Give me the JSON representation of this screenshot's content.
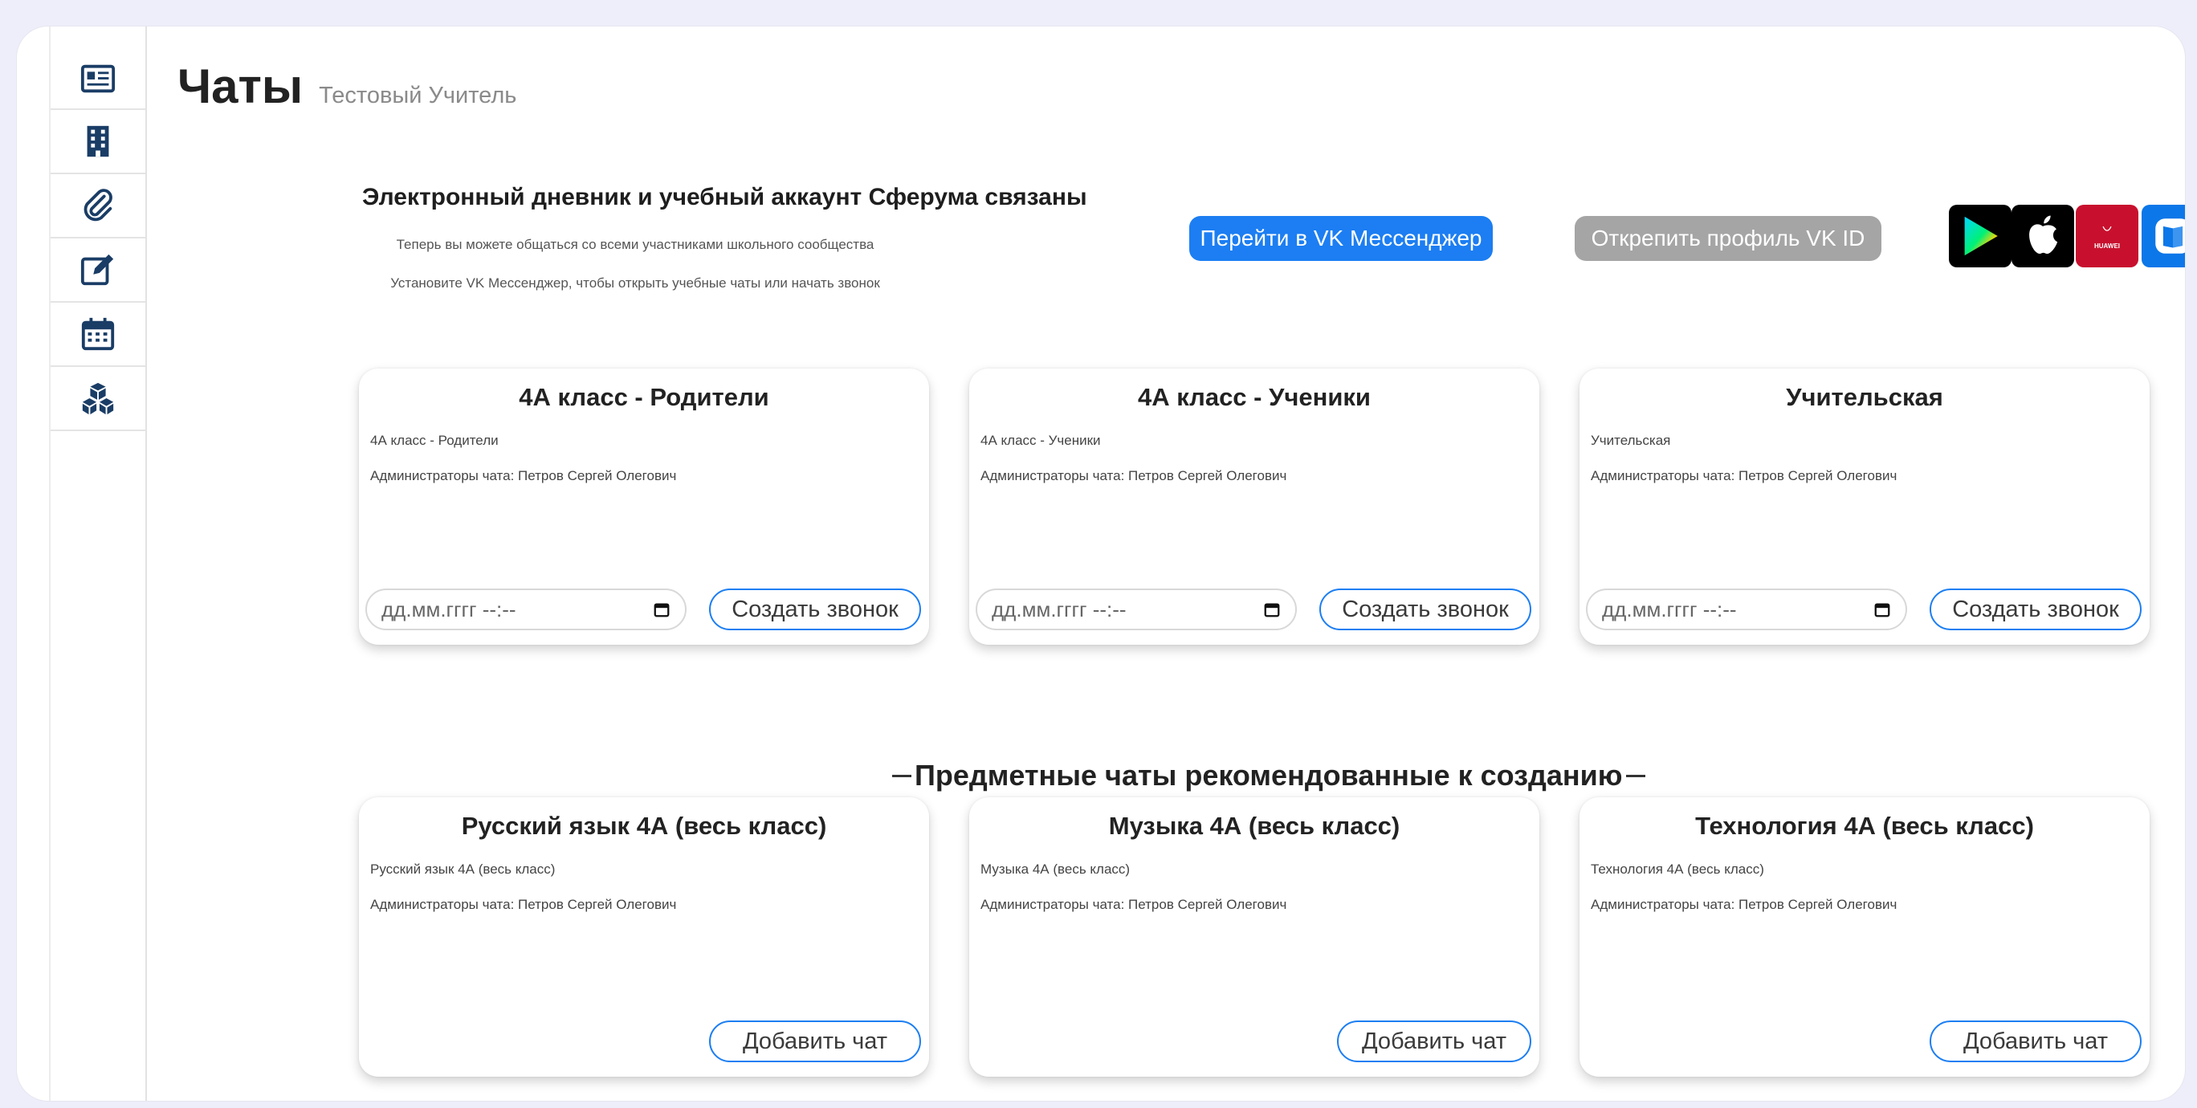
{
  "page": {
    "title": "Чаты",
    "subtitle": "Тестовый Учитель"
  },
  "sidebar": {
    "items": [
      {
        "icon": "news-icon"
      },
      {
        "icon": "building-icon"
      },
      {
        "icon": "paperclip-icon"
      },
      {
        "icon": "edit-icon"
      },
      {
        "icon": "calendar-icon"
      },
      {
        "icon": "cubes-icon"
      }
    ]
  },
  "banner": {
    "heading": "Электронный дневник и учебный аккаунт Сферума связаны",
    "line1": "Теперь вы можете общаться со всеми участниками школьного сообщества",
    "line2": "Установите VK Мессенджер, чтобы открыть учебные чаты или начать звонок",
    "vk_button": "Перейти в VK Мессенджер",
    "unlink_button": "Открепить профиль VK ID",
    "stores": [
      "google-play-icon",
      "apple-icon",
      "huawei-icon",
      "rustore-icon"
    ],
    "huawei_label": "HUAWEI"
  },
  "chats": [
    {
      "title": "4А класс - Родители",
      "subtitle": "4А класс - Родители",
      "admins": "Администраторы чата: Петров Сергей Олегович",
      "date_placeholder": "дд.мм.гггг --:--",
      "button": "Создать звонок"
    },
    {
      "title": "4А класс - Ученики",
      "subtitle": "4А класс - Ученики",
      "admins": "Администраторы чата: Петров Сергей Олегович",
      "date_placeholder": "дд.мм.гггг --:--",
      "button": "Создать звонок"
    },
    {
      "title": "Учительская",
      "subtitle": "Учительская",
      "admins": "Администраторы чата: Петров Сергей Олегович",
      "date_placeholder": "дд.мм.гггг --:--",
      "button": "Создать звонок"
    }
  ],
  "recommended": {
    "heading": "Предметные чаты рекомендованные к созданию",
    "items": [
      {
        "title": "Русский язык 4А (весь класс)",
        "subtitle": "Русский язык 4А (весь класс)",
        "admins": "Администраторы чата: Петров Сергей Олегович",
        "button": "Добавить чат"
      },
      {
        "title": "Музыка 4А (весь класс)",
        "subtitle": "Музыка 4А (весь класс)",
        "admins": "Администраторы чата: Петров Сергей Олегович",
        "button": "Добавить чат"
      },
      {
        "title": "Технология 4А (весь класс)",
        "subtitle": "Технология 4А (весь класс)",
        "admins": "Администраторы чата: Петров Сергей Олегович",
        "button": "Добавить чат"
      }
    ]
  },
  "colors": {
    "accent": "#1c7ef2",
    "muted_button": "#a5a5a5",
    "huawei": "#c8102e",
    "rustore": "#0c77e8"
  }
}
